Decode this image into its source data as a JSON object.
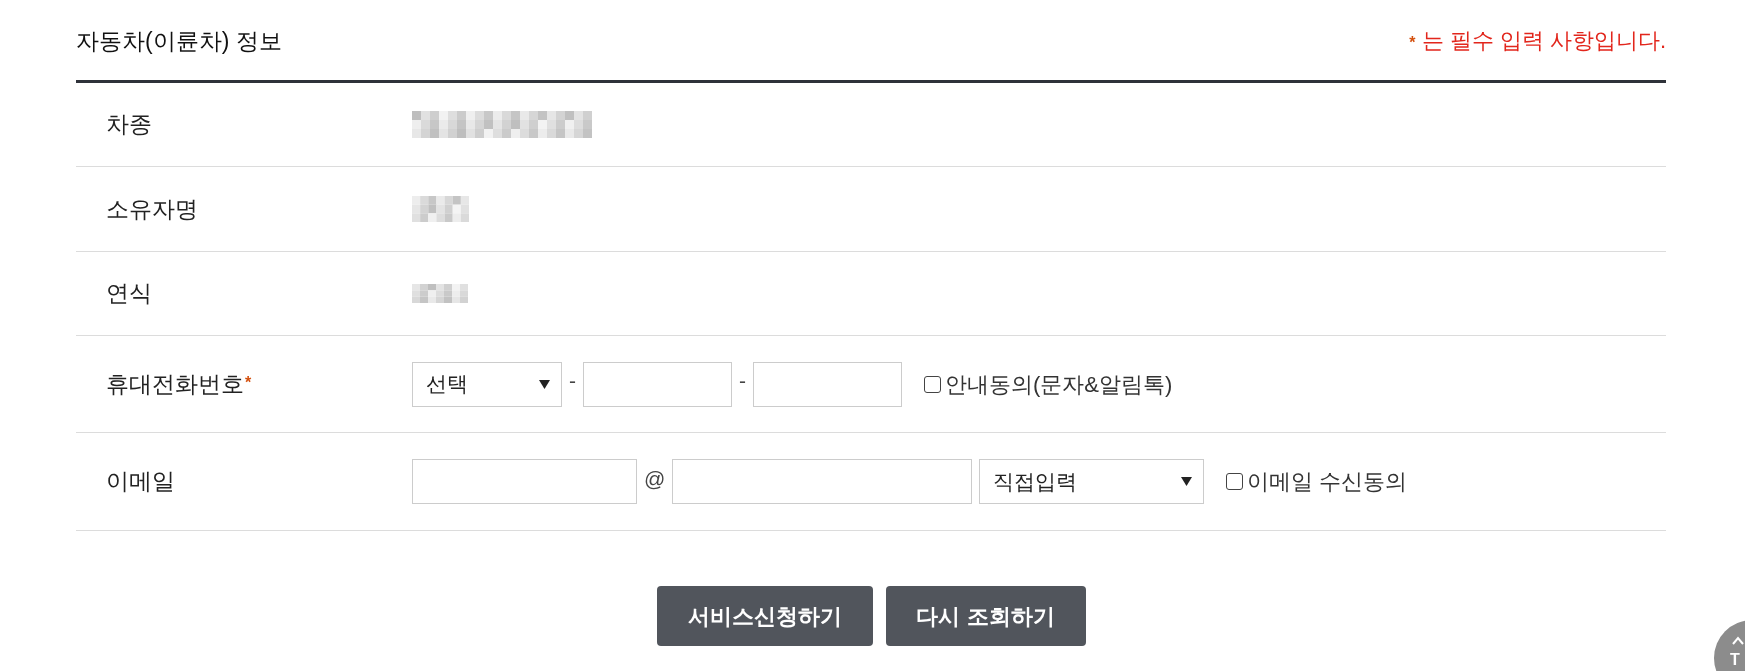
{
  "section": {
    "title": "자동차(이륜차) 정보",
    "required_note": {
      "mark": "*",
      "text": "는 필수 입력 사항입니다."
    }
  },
  "rows": [
    {
      "kind": "redacted",
      "label": "차종"
    },
    {
      "kind": "redacted",
      "label": "소유자명"
    },
    {
      "kind": "redacted",
      "label": "연식"
    },
    {
      "kind": "phone",
      "label": "휴대전화번호",
      "mark": "*",
      "controls": [
        {
          "kind": "select",
          "value": "선택"
        },
        {
          "kind": "separator",
          "text": "-"
        },
        {
          "kind": "input"
        },
        {
          "kind": "separator",
          "text": "-"
        },
        {
          "kind": "input"
        },
        {
          "kind": "checkbox",
          "label": "안내동의(문자&알림톡)",
          "checked": false
        }
      ]
    },
    {
      "kind": "email",
      "label": "이메일",
      "controls": [
        {
          "kind": "input"
        },
        {
          "kind": "separator",
          "text": "@"
        },
        {
          "kind": "input"
        },
        {
          "kind": "select",
          "value": "직접입력"
        },
        {
          "kind": "checkbox",
          "label": "이메일 수신동의",
          "checked": false
        }
      ]
    }
  ],
  "buttons": [
    {
      "label": "서비스신청하기"
    },
    {
      "label": "다시 조회하기"
    }
  ],
  "top_button": {
    "label": "T"
  }
}
